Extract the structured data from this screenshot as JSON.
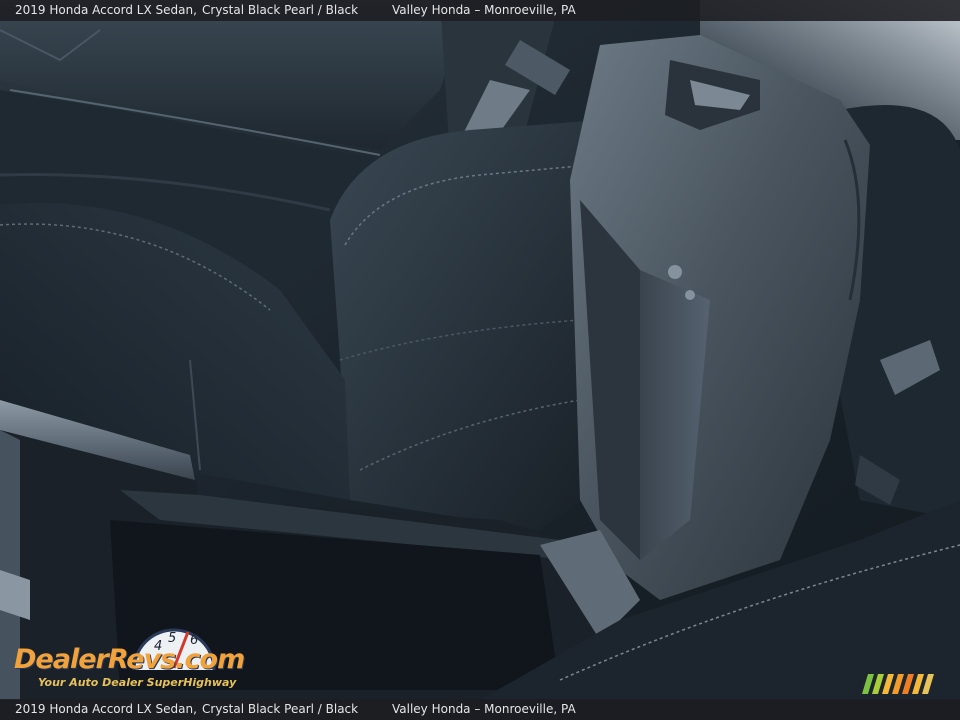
{
  "caption": {
    "title": "2019 Honda Accord LX Sedan,",
    "color": "Crystal Black Pearl / Black",
    "dealer": "Valley Honda – Monroeville, PA"
  },
  "watermark": {
    "brand": "DealerRevs.com",
    "tagline": "Your Auto Dealer SuperHighway",
    "gauge_digits": [
      "4",
      "5",
      "6"
    ]
  },
  "photo": {
    "subject": "Honda Accord interior – center console armrest lifted open between front seats",
    "colors": {
      "cabin_dark": "#1a242c",
      "seat_fabric": "#222c35",
      "armrest": "#3a444e",
      "light_haze": "#8fa3b3"
    }
  }
}
